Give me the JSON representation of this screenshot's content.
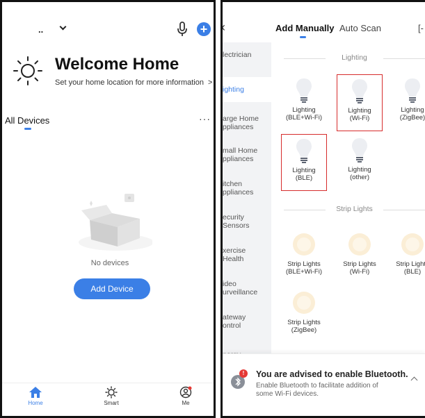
{
  "left": {
    "home_selector_suffix": "..",
    "welcome_title": "Welcome Home",
    "welcome_sub": "Set your home location for more information",
    "welcome_sub_arrow": ">",
    "all_devices_tab": "All Devices",
    "more_icon_text": "···",
    "empty_text": "No devices",
    "add_device_button": "Add Device",
    "tabbar": [
      {
        "label": "Home",
        "icon": "home-icon"
      },
      {
        "label": "Smart",
        "icon": "sun-icon"
      },
      {
        "label": "Me",
        "icon": "profile-icon"
      }
    ],
    "accent": "#3b7fe6"
  },
  "right": {
    "tabs": {
      "manual": "Add Manually",
      "auto": "Auto Scan"
    },
    "scan_icon_text": "[-",
    "sidebar": [
      "lectrician",
      "ighting",
      "arge Home\nppliances",
      "mall Home\nppliances",
      "itchen\nppliances",
      "ecurity\n Sensors",
      "xercise\n Health",
      "ideo\nurveillance",
      "ateway\nontrol",
      "nergy"
    ],
    "sections": {
      "lighting": "Lighting",
      "strip": "Strip Lights"
    },
    "lighting_devices": [
      "Lighting\n(BLE+Wi-Fi)",
      "Lighting\n(Wi-Fi)",
      "Lighting\n(ZigBee)",
      "Lighting\n(BLE)",
      "Lighting\n(other)"
    ],
    "strip_devices": [
      "Strip Lights\n(BLE+Wi-Fi)",
      "Strip Lights\n(Wi-Fi)",
      "Strip Lights\n(BLE)",
      "Strip Lights\n(ZigBee)"
    ],
    "toast": {
      "title": "You are advised to enable Bluetooth.",
      "body": "Enable Bluetooth to facilitate addition of some Wi-Fi devices.",
      "badge": "!"
    },
    "highlight_color": "#d62b2b"
  }
}
